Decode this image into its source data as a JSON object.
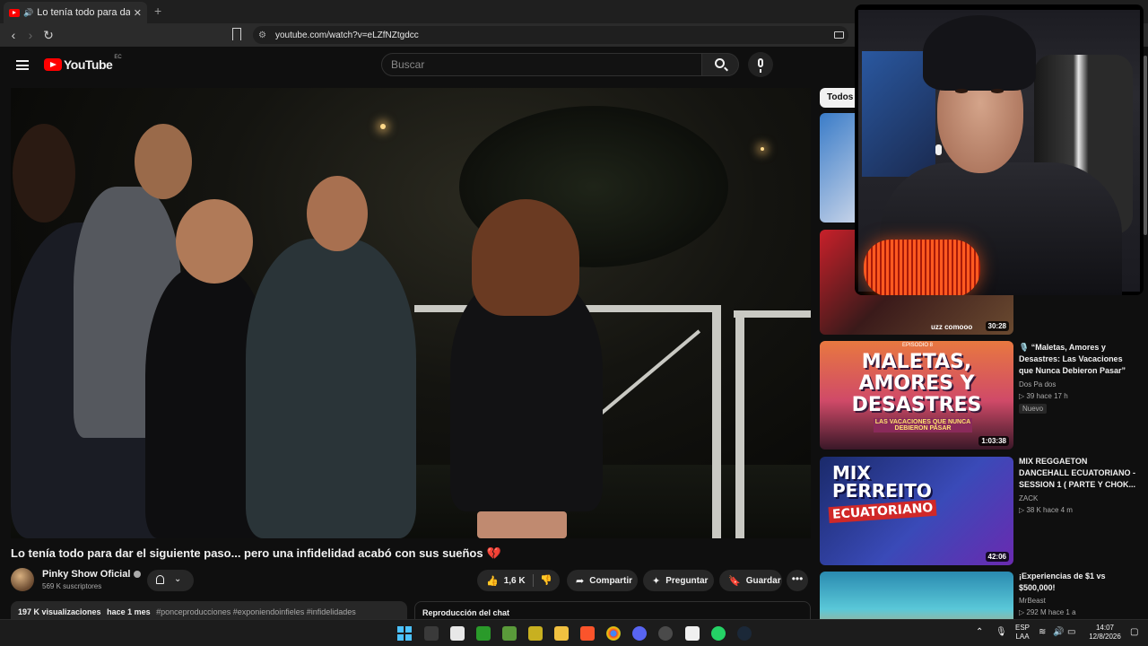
{
  "browser": {
    "tab_title": "Lo tenía todo para dar el siguie",
    "tab_close": "✕",
    "new_tab": "+",
    "url": "youtube.com/watch?v=eLZfNZtgdcc"
  },
  "header": {
    "logo_text": "YouTube",
    "country_code": "EC",
    "search_placeholder": "Buscar"
  },
  "video": {
    "title": "Lo tenía todo para dar el siguiente paso... pero una infidelidad acabó con sus sueños",
    "title_emoji": "💔",
    "channel_name": "Pinky Show Oficial",
    "subscribers": "569 K suscriptores",
    "likes": "1,6 K",
    "share_label": "Compartir",
    "ask_label": "Preguntar",
    "save_label": "Guardar",
    "more_label": "•••",
    "views": "197 K visualizaciones",
    "age": "hace 1 mes",
    "hashtags": "#ponceproducciones #exponiendoinfieles #infidelidades",
    "chat_replay_label": "Reproducción del chat"
  },
  "sidebar": {
    "chip_all": "Todos",
    "items": [
      {
        "duration": "",
        "title": "",
        "channel": "",
        "meta": ""
      },
      {
        "duration": "30:28",
        "title": "",
        "channel": "",
        "meta": "",
        "thumb_text": "uzz comooo"
      },
      {
        "duration": "1:03:38",
        "title": "🎙️ “Maletas, Amores y Desastres: Las Vacaciones que Nunca Debieron Pasar”",
        "channel": "Dos Pa dos",
        "meta": "▷ 39  hace 17 h",
        "badge": "Nuevo",
        "thumb_small": "EPISODIO 8",
        "thumb_big": "MALETAS, AMORES Y DESASTRES",
        "thumb_sub": "LAS VACACIONES QUE NUNCA DEBIERON PASAR"
      },
      {
        "duration": "42:06",
        "title": "MIX REGGAETON DANCEHALL ECUATORIANO - SESSION 1 ( PARTE Y CHOK...",
        "channel": "ZACK",
        "meta": "▷ 38 K  hace 4 m",
        "thumb_big": "MIX PERREITO",
        "thumb_big2": "ECUATORIANO"
      },
      {
        "duration": "",
        "title": "¡Experiencias de $1 vs $500,000!",
        "channel": "MrBeast",
        "meta": "▷ 292 M  hace 1 a"
      }
    ]
  },
  "taskbar": {
    "language": "ESP",
    "layout": "LAA",
    "time": "14:07",
    "date": "12/8/2026"
  },
  "colors": {
    "yt_red": "#ff0000",
    "background": "#0f0f0f",
    "pill": "#272727",
    "heart": "#e8254a"
  }
}
